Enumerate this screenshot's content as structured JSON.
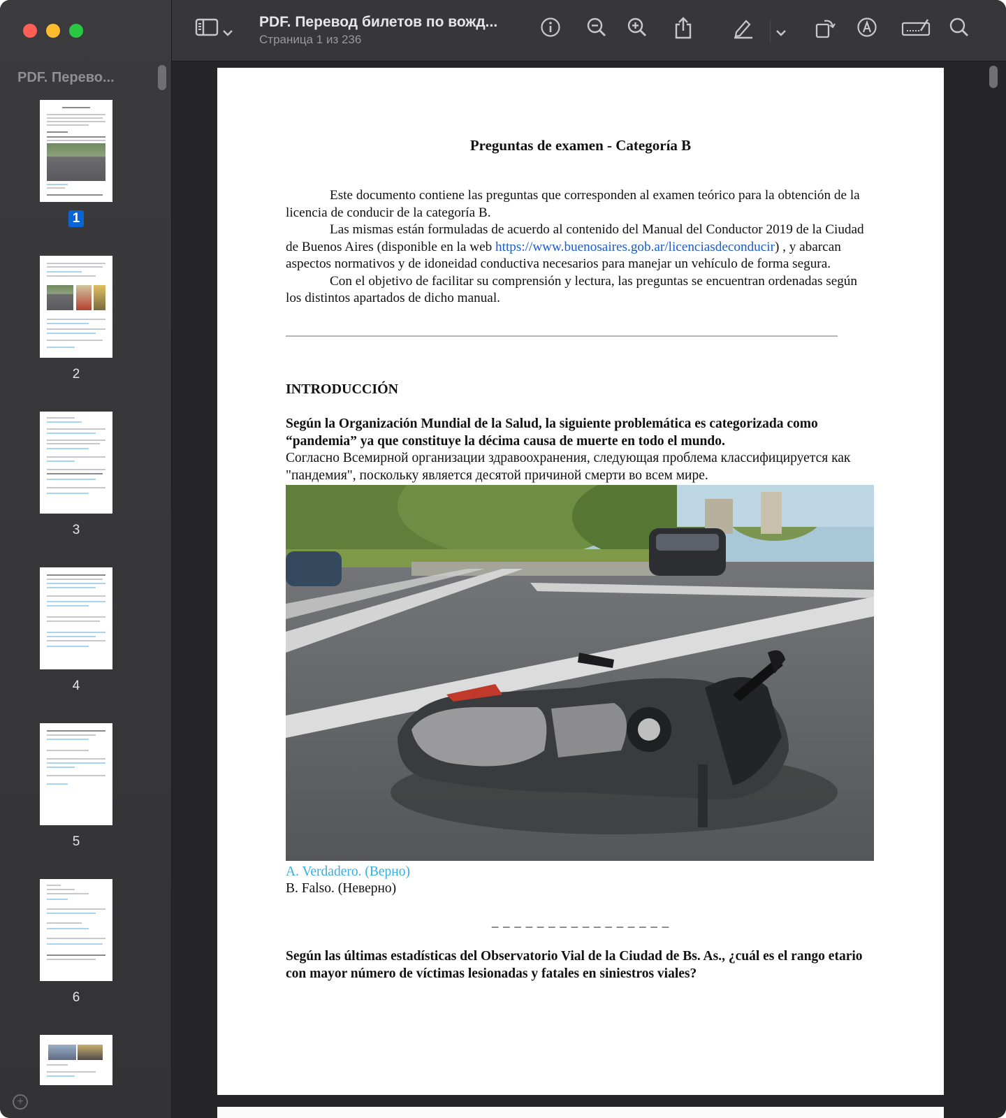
{
  "window": {
    "title": "PDF. Перевод билетов по вожд...",
    "subtitle": "Страница 1 из 236"
  },
  "sidebar": {
    "title": "PDF. Перево...",
    "thumbnails": [
      {
        "label": "1",
        "selected": true
      },
      {
        "label": "2",
        "selected": false
      },
      {
        "label": "3",
        "selected": false
      },
      {
        "label": "4",
        "selected": false
      },
      {
        "label": "5",
        "selected": false
      },
      {
        "label": "6",
        "selected": false
      }
    ]
  },
  "toolbar": {
    "icons": [
      "sidebar-toggle-icon",
      "chevron-down-icon",
      "info-icon",
      "zoom-out-icon",
      "zoom-in-icon",
      "share-icon",
      "highlight-pen-icon",
      "chevron-down-icon",
      "rotate-icon",
      "markup-icon",
      "signature-icon",
      "search-icon"
    ]
  },
  "document": {
    "title": "Preguntas de examen - Categoría B",
    "intro_p1": "Este documento contiene las preguntas que corresponden al examen teórico para la obtención de la licencia de conducir de la categoría B.",
    "intro_p2_before": "Las mismas están formuladas de acuerdo al contenido del Manual del Conductor 2019 de la Ciudad de Buenos Aires (disponible en la web ",
    "intro_link": "https://www.buenosaires.gob.ar/licenciasdeconducir",
    "intro_p2_after": ") , y abarcan aspectos normativos y de idoneidad conductiva necesarios para manejar un vehículo de forma segura.",
    "intro_p3": "Con el objetivo de facilitar su comprensión y lectura, las preguntas se encuentran ordenadas según los distintos apartados de dicho manual.",
    "section_heading": "INTRODUCCIÓN",
    "q1_es": "Según la Organización Mundial de la Salud, la siguiente problemática es categorizada como “pandemia” ya que constituye la décima causa de muerte en todo el mundo.",
    "q1_ru": "Согласно Всемирной организации здравоохранения, следующая проблема классифицируется как \"пандемия\", поскольку является десятой причиной смерти во всем мире.",
    "answer_a": "A. Verdadero. (Верно)",
    "answer_b": "B. Falso. (Неверно)",
    "separator": "_ _ _ _ _ _ _ _ _ _ _ _ _ _ _ _",
    "q2_es": "Según las últimas estadísticas del Observatorio Vial de la Ciudad de Bs. As., ¿cuál es el rango etario con mayor número de víctimas lesionadas y fatales en siniestros viales?"
  },
  "colors": {
    "correct_answer": "#34aee0",
    "link": "#1a5bd1",
    "selection": "#0a64d6"
  }
}
